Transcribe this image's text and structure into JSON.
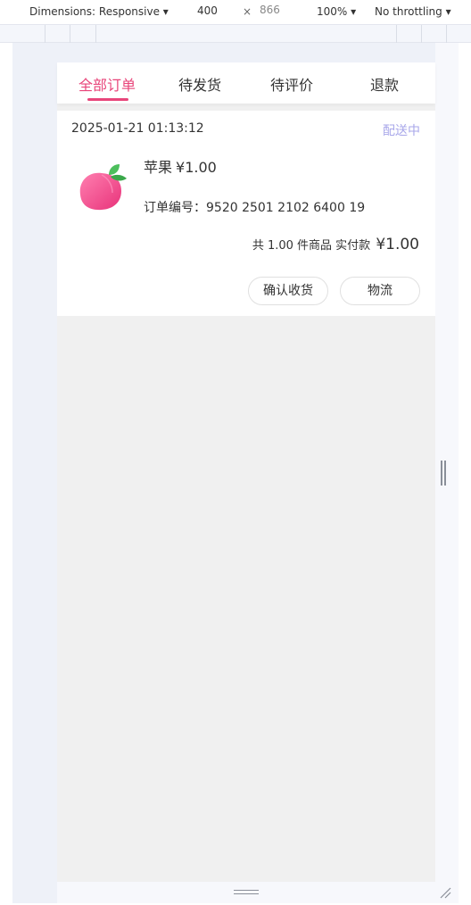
{
  "devtools": {
    "dimensions_label": "Dimensions: Responsive ▾",
    "width_value": "400",
    "times": "×",
    "height_value": "866",
    "zoom": "100% ▾",
    "throttling": "No throttling ▾"
  },
  "tabs": [
    {
      "label": "全部订单",
      "active": true
    },
    {
      "label": "待发货"
    },
    {
      "label": "待评价"
    },
    {
      "label": "退款"
    }
  ],
  "order": {
    "time": "2025-01-21 01:13:12",
    "status": "配送中",
    "product_name": "苹果",
    "product_price": "¥1.00",
    "order_no": "订单编号：9520 2501 2102 6400 19",
    "summary_text": "共 1.00 件商品 实付款",
    "paid_amount": "¥1.00",
    "confirm_button": "确认收货",
    "logistics_button": "物流"
  },
  "colors": {
    "accent": "#e8457a",
    "status": "#a8a7ea",
    "page_bg": "#f0f0f0"
  }
}
